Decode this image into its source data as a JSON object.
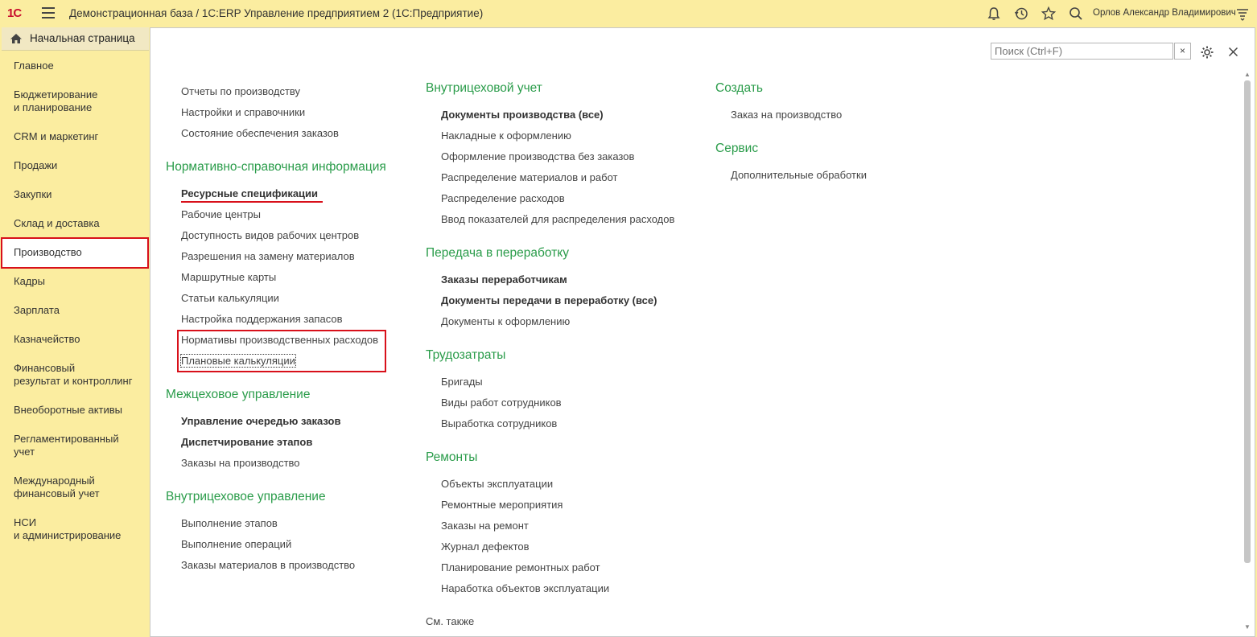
{
  "header": {
    "logo": "1С",
    "title": "Демонстрационная база / 1С:ERP Управление предприятием 2  (1С:Предприятие)",
    "user": "Орлов Александр Владимирович"
  },
  "sidebar": {
    "home": "Начальная страница",
    "items": [
      {
        "label": "Главное"
      },
      {
        "label": "Бюджетирование\nи планирование"
      },
      {
        "label": "CRM и маркетинг"
      },
      {
        "label": "Продажи"
      },
      {
        "label": "Закупки"
      },
      {
        "label": "Склад и доставка"
      },
      {
        "label": "Производство"
      },
      {
        "label": "Кадры"
      },
      {
        "label": "Зарплата"
      },
      {
        "label": "Казначейство"
      },
      {
        "label": "Финансовый\nрезультат и контроллинг"
      },
      {
        "label": "Внеоборотные активы"
      },
      {
        "label": "Регламентированный\nучет"
      },
      {
        "label": "Международный\nфинансовый учет"
      },
      {
        "label": "НСИ\nи администрирование"
      }
    ],
    "selected": "Производство"
  },
  "search": {
    "placeholder": "Поиск (Ctrl+F)",
    "clear": "×"
  },
  "col1": {
    "top": [
      "Отчеты по производству",
      "Настройки и справочники",
      "Состояние обеспечения заказов"
    ],
    "nsi_title": "Нормативно-справочная информация",
    "nsi": [
      "Ресурсные спецификации",
      "Рабочие центры",
      "Доступность видов рабочих центров",
      "Разрешения на замену материалов",
      "Маршрутные карты",
      "Статьи калькуляции",
      "Настройка поддержания запасов",
      "Нормативы производственных расходов",
      "Плановые калькуляции"
    ],
    "mezh_title": "Межцеховое управление",
    "mezh": [
      "Управление очередью заказов",
      "Диспетчирование этапов",
      "Заказы на производство"
    ],
    "vnutr_title": "Внутрицеховое управление",
    "vnutr": [
      "Выполнение этапов",
      "Выполнение операций",
      "Заказы материалов в производство"
    ]
  },
  "col2": {
    "uchet_title": "Внутрицеховой учет",
    "uchet": [
      "Документы производства (все)",
      "Накладные к оформлению",
      "Оформление производства без заказов",
      "Распределение материалов и работ",
      "Распределение расходов",
      "Ввод показателей для распределения расходов"
    ],
    "pered_title": "Передача в переработку",
    "pered": [
      "Заказы переработчикам",
      "Документы передачи в переработку (все)",
      "Документы к оформлению"
    ],
    "trud_title": "Трудозатраты",
    "trud": [
      "Бригады",
      "Виды работ сотрудников",
      "Выработка сотрудников"
    ],
    "rem_title": "Ремонты",
    "rem": [
      "Объекты эксплуатации",
      "Ремонтные мероприятия",
      "Заказы на ремонт",
      "Журнал дефектов",
      "Планирование ремонтных работ",
      "Наработка объектов эксплуатации"
    ],
    "see_also": "См. также"
  },
  "col3": {
    "create_title": "Создать",
    "create": [
      "Заказ на производство"
    ],
    "service_title": "Сервис",
    "service": [
      "Дополнительные обработки"
    ]
  }
}
